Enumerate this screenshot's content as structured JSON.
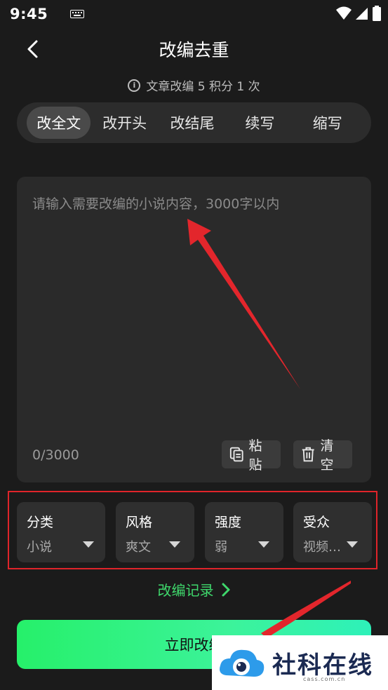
{
  "status": {
    "time": "9:45"
  },
  "header": {
    "title": "改编去重"
  },
  "info": {
    "text": "文章改编 5 积分 1 次"
  },
  "tabs": [
    {
      "label": "改全文",
      "active": true
    },
    {
      "label": "改开头"
    },
    {
      "label": "改结尾"
    },
    {
      "label": "续写"
    },
    {
      "label": "缩写"
    }
  ],
  "editor": {
    "placeholder": "请输入需要改编的小说内容，3000字以内",
    "counter": "0/3000",
    "paste_label": "粘贴",
    "clear_label": "清空"
  },
  "options": [
    {
      "label": "分类",
      "value": "小说"
    },
    {
      "label": "风格",
      "value": "爽文"
    },
    {
      "label": "强度",
      "value": "弱"
    },
    {
      "label": "受众",
      "value": "视频…"
    }
  ],
  "records": {
    "label": "改编记录"
  },
  "submit": {
    "label": "立即改编"
  },
  "watermark": {
    "text": "社科在线",
    "sub": "cass.com.cn"
  },
  "colors": {
    "background": "#1b1b1b",
    "accent_green": "#3fd86c",
    "highlight_red": "#e0242a",
    "button_gradient_start": "#26f06a",
    "button_gradient_end": "#2ef1b9"
  }
}
